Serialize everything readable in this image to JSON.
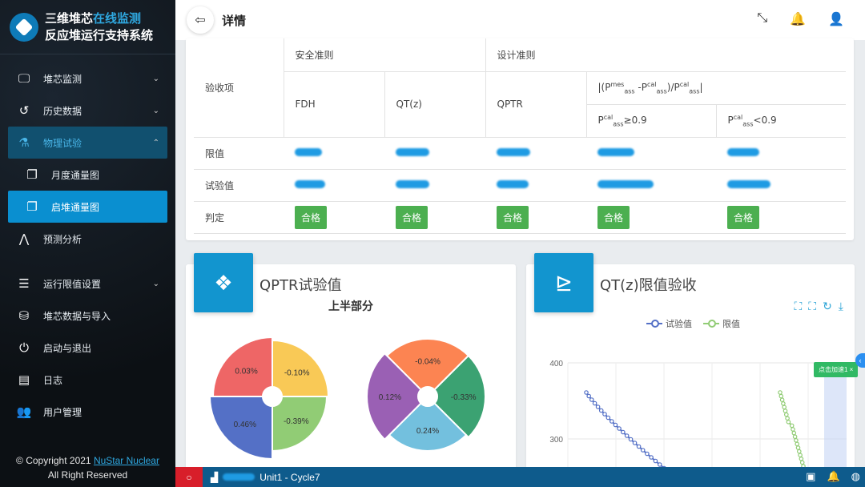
{
  "brand": {
    "line1_a": "三维堆芯",
    "line1_b": "在线监测",
    "line2": "反应堆运行支持系统"
  },
  "nav": [
    {
      "label": "堆芯监测",
      "icon": "monitor-icon"
    },
    {
      "label": "历史数据",
      "icon": "history-icon"
    },
    {
      "label": "物理试验",
      "icon": "flask-icon"
    },
    {
      "label": "月度通量图",
      "icon": "copy-icon"
    },
    {
      "label": "启堆通量图",
      "icon": "copy-icon"
    },
    {
      "label": "预测分析",
      "icon": "chart-icon"
    },
    {
      "label": "运行限值设置",
      "icon": "sliders-icon"
    },
    {
      "label": "堆芯数据与导入",
      "icon": "database-icon"
    },
    {
      "label": "启动与退出",
      "icon": "power-icon"
    },
    {
      "label": "日志",
      "icon": "log-icon"
    },
    {
      "label": "用户管理",
      "icon": "users-icon"
    }
  ],
  "copyright": {
    "text": "© Copyright 2021 ",
    "link": "NuStar Nuclear",
    "line2": "All Right Reserved"
  },
  "header": {
    "title": "详情"
  },
  "table": {
    "col_item": "验收项",
    "group_safety": "安全准则",
    "group_design": "设计准则",
    "col_fdh": "FDH",
    "col_qtz": "QT(z)",
    "col_qptr": "QPTR",
    "row_limit": "限值",
    "row_test": "试验值",
    "row_judge": "判定",
    "pass": "合格"
  },
  "chart1": {
    "title": "QPTR试验值",
    "subtitle": "上半部分"
  },
  "chart2": {
    "title": "QT(z)限值验收",
    "legend_test": "试验值",
    "legend_limit": "限值",
    "y_tick_400": "400",
    "y_tick_300": "300",
    "tag": "点击加速1"
  },
  "chart_data": [
    {
      "type": "pie",
      "title": "上半部分",
      "series": [
        {
          "values": [
            -0.1,
            -0.39,
            0.46,
            0.03
          ],
          "labels": [
            "-0.10%",
            "-0.39%",
            "0.46%",
            "0.03%"
          ],
          "colors": [
            "#f9c956",
            "#91cc75",
            "#5470c6",
            "#ee6666"
          ]
        },
        {
          "values": [
            -0.04,
            -0.33,
            0.24,
            0.12
          ],
          "labels": [
            "-0.04%",
            "-0.33%",
            "0.24%",
            "0.12%"
          ],
          "colors": [
            "#fc8452",
            "#3ba272",
            "#73c0de",
            "#9a60b4"
          ]
        }
      ]
    },
    {
      "type": "line",
      "series": [
        {
          "name": "试验值",
          "color": "#5470c6"
        },
        {
          "name": "限值",
          "color": "#91cc75"
        }
      ],
      "y_ticks": [
        400,
        300
      ]
    }
  ],
  "footer": {
    "project": "Unit1 - Cycle7"
  }
}
